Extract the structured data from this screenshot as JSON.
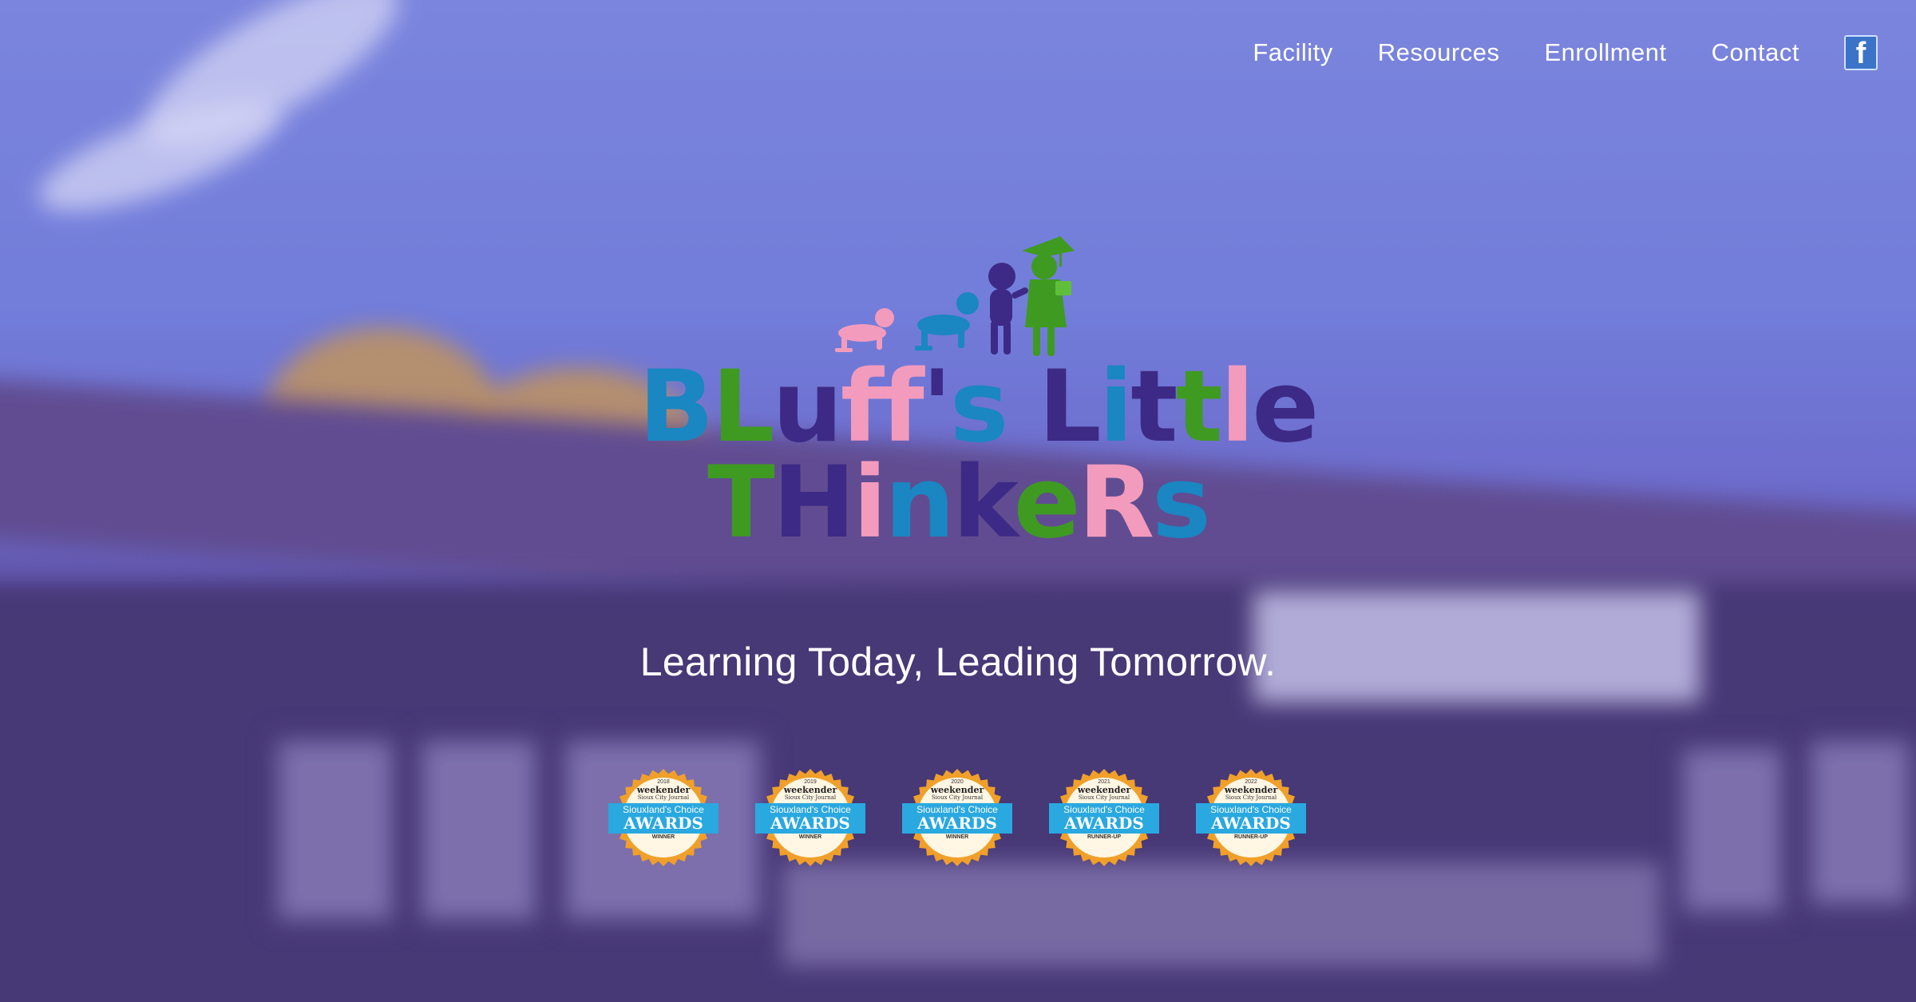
{
  "nav": {
    "items": [
      {
        "label": "Facility"
      },
      {
        "label": "Resources"
      },
      {
        "label": "Enrollment"
      },
      {
        "label": "Contact"
      }
    ],
    "social_icon": "facebook-icon",
    "social_glyph": "f"
  },
  "logo": {
    "line1": "BLuff's Little",
    "line2": "THinkeRs",
    "silhouettes": [
      "crawling-baby",
      "crawling-toddler",
      "walking-child",
      "graduate-child"
    ]
  },
  "tagline": "Learning Today, Leading Tomorrow.",
  "awards": [
    {
      "year": "2018",
      "brand": "weekender",
      "publication": "Sioux City Journal",
      "subtitle": "Siouxland's Choice",
      "title": "AWARDS",
      "result": "WINNER"
    },
    {
      "year": "2019",
      "brand": "weekender",
      "publication": "Sioux City Journal",
      "subtitle": "Siouxland's Choice",
      "title": "AWARDS",
      "result": "WINNER"
    },
    {
      "year": "2020",
      "brand": "weekender",
      "publication": "Sioux City Journal",
      "subtitle": "Siouxland's Choice",
      "title": "AWARDS",
      "result": "WINNER"
    },
    {
      "year": "2021",
      "brand": "weekender",
      "publication": "Sioux City Journal",
      "subtitle": "Siouxland's Choice",
      "title": "AWARDS",
      "result": "RUNNER-UP"
    },
    {
      "year": "2022",
      "brand": "weekender",
      "publication": "Sioux City Journal",
      "subtitle": "Siouxland's Choice",
      "title": "AWARDS",
      "result": "RUNNER-UP"
    }
  ],
  "colors": {
    "logo_blue": "#1a86c2",
    "logo_pink": "#f39bbd",
    "logo_purple": "#3d2a86",
    "logo_green": "#3f9a22",
    "badge_orange": "#f0a02a",
    "badge_blue": "#2aa8e0"
  }
}
